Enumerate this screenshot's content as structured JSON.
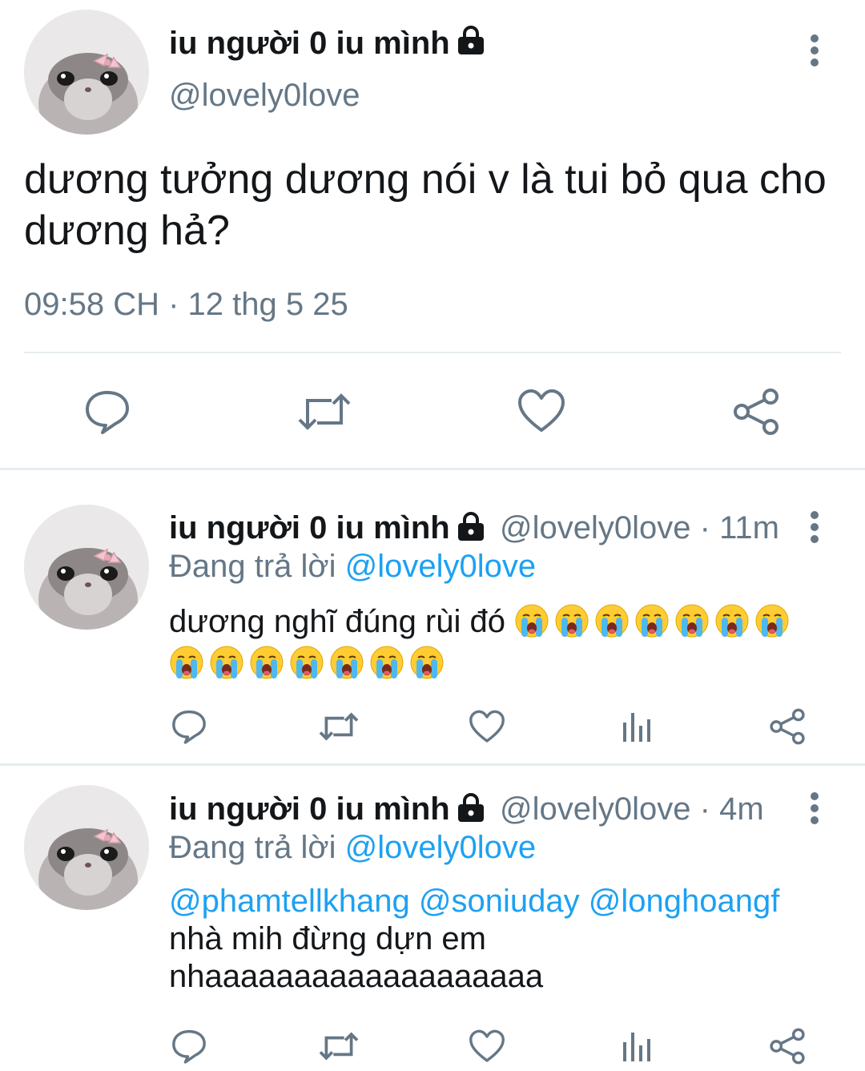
{
  "main_tweet": {
    "display_name": "iu người 0 iu mình",
    "handle": "@lovely0love",
    "text": "dương tưởng dương nói v là tui bỏ qua cho dương hả?",
    "timestamp": "09:58 CH · 12 thg 5 25",
    "icons": [
      "lock-icon",
      "more-vertical-icon",
      "reply-icon",
      "retweet-icon",
      "like-icon",
      "share-icon"
    ]
  },
  "replies": [
    {
      "display_name": "iu người 0 iu mình",
      "handle": "@lovely0love",
      "separator": "·",
      "time": "11m",
      "replying_label": "Đang trả lời",
      "replying_to": "@lovely0love",
      "text": "dương nghĩ đúng rùi đó",
      "emoji": "😭",
      "emoji_count": 14,
      "icons": [
        "reply-icon",
        "retweet-icon",
        "like-icon",
        "analytics-icon",
        "share-icon"
      ]
    },
    {
      "display_name": "iu người 0 iu mình",
      "handle": "@lovely0love",
      "separator": "·",
      "time": "4m",
      "replying_label": "Đang trả lời",
      "replying_to": "@lovely0love",
      "mentions": "@phamtellkhang @soniuday @longhoangf",
      "text_line1": "nhà mih đừng dựn em",
      "text_line2": "nhaaaaaaaaaaaaaaaaaaa",
      "icons": [
        "reply-icon",
        "retweet-icon",
        "like-icon",
        "analytics-icon",
        "share-icon"
      ]
    }
  ],
  "colors": {
    "text": "#14171a",
    "muted": "#657786",
    "accent": "#1da1f2",
    "divider": "#e6ecf0"
  }
}
